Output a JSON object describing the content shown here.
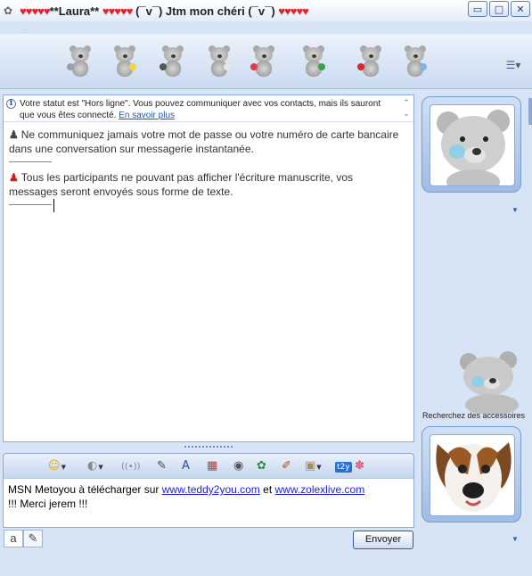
{
  "window": {
    "title_hearts_left": "♥♥♥♥♥",
    "title_name": "**Laura**",
    "title_hearts_mid": "♥♥♥♥♥",
    "title_message": "(¯v¯) Jtm mon chéri (¯v¯)",
    "title_hearts_right": "♥♥♥♥♥",
    "subtitle": "…",
    "minimize_icon": "▭",
    "maximize_icon": "□",
    "close_icon": "✕"
  },
  "toolbar": {
    "items": [
      {
        "name": "invite-bear",
        "accent": "#9aa0a6"
      },
      {
        "name": "share-files-bear",
        "accent": "#f2d24c"
      },
      {
        "name": "webcam-bear",
        "accent": "#555555"
      },
      {
        "name": "call-bear",
        "accent": "#e6e6e6"
      },
      {
        "name": "activities-bear",
        "accent": "#e23a4a"
      },
      {
        "name": "games-bear",
        "accent": "#3aa14a"
      },
      {
        "name": "block-bear",
        "accent": "#d9262f"
      },
      {
        "name": "wand-bear",
        "accent": "#7cb4e6"
      }
    ],
    "menu_icon": "☰▾"
  },
  "conversation": {
    "info_icon": "i",
    "info_text": "Votre statut est \"Hors ligne\". Vous pouvez communiquer avec vos contacts, mais ils sauront que vous êtes connecté.",
    "info_link": "En savoir plus",
    "info_scroll_up": "⌃",
    "info_scroll_down": "⌄",
    "warning_1": "Ne communiquez jamais votre mot de passe ou votre numéro de carte bancaire dans une conversation sur messagerie instantanée.",
    "warning_2": "Tous les participants ne pouvant pas afficher l'écriture manuscrite, vos messages seront envoyés sous forme de texte."
  },
  "formatbar": {
    "items": [
      {
        "name": "emoticon-button",
        "glyph": "☺",
        "color": "#e0a800",
        "dropdown": true
      },
      {
        "name": "wink-button",
        "glyph": "◐",
        "color": "#8a8a8a",
        "dropdown": true
      },
      {
        "name": "nudge-button",
        "glyph": "((•))",
        "color": "#7a8aa0",
        "dropdown": false
      },
      {
        "name": "voice-clip-button",
        "glyph": "✎",
        "color": "#445",
        "dropdown": false
      },
      {
        "name": "font-button",
        "glyph": "A",
        "color": "#2a4fa0",
        "dropdown": false
      },
      {
        "name": "background-button",
        "glyph": "▦",
        "color": "#c0392b",
        "dropdown": false
      },
      {
        "name": "sound-button",
        "glyph": "◉",
        "color": "#555",
        "dropdown": false
      },
      {
        "name": "color-button",
        "glyph": "✿",
        "color": "#2d8a3a",
        "dropdown": false
      },
      {
        "name": "pencil-button",
        "glyph": "✐",
        "color": "#a0522d",
        "dropdown": false
      },
      {
        "name": "image-button",
        "glyph": "▣",
        "color": "#a58a5a",
        "dropdown": true
      },
      {
        "name": "t2y-button",
        "glyph": "t2y",
        "color": "#ffffff",
        "dropdown": false
      },
      {
        "name": "addon-button",
        "glyph": "✽",
        "color": "#d9507a",
        "dropdown": false
      }
    ]
  },
  "input": {
    "text_1": "MSN Metoyou à télécharger sur ",
    "link_1": "www.teddy2you.com",
    "text_2": " et ",
    "link_2": "www.zolexlive.com",
    "text_3": "!!! Merci jerem !!!"
  },
  "bottom": {
    "tab_text_icon": "a",
    "tab_handwriting_icon": "✎",
    "send_label": "Envoyer"
  },
  "sidebar": {
    "accessory_label": "Recherchez des accessoires",
    "dropdown_icon": "▼"
  }
}
